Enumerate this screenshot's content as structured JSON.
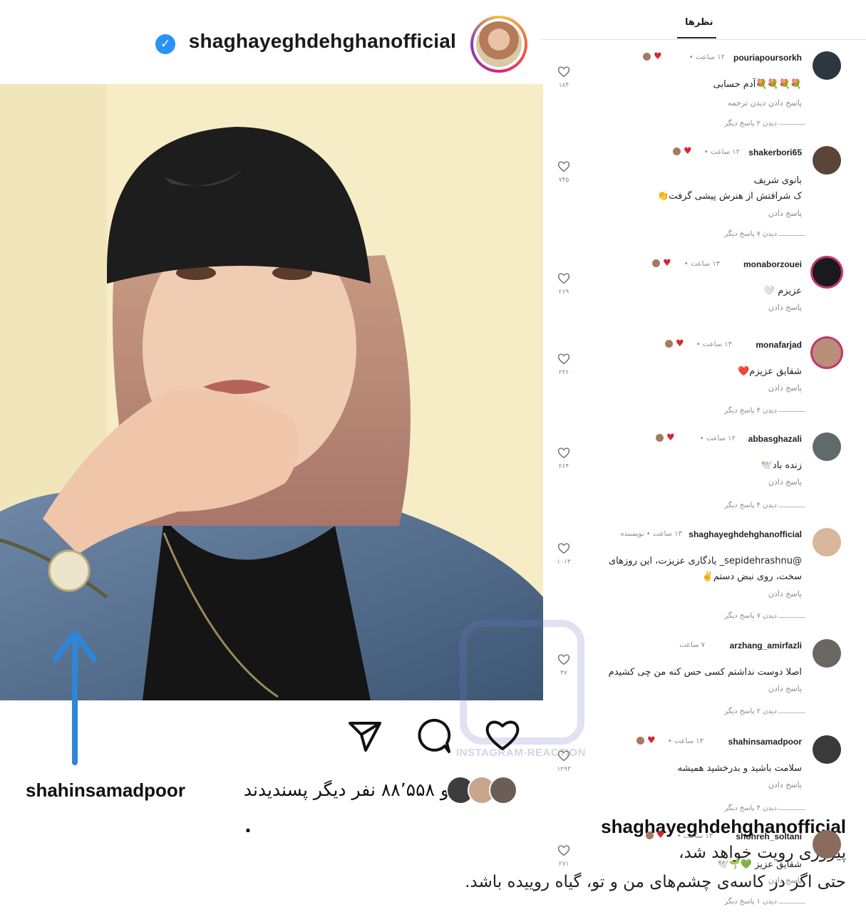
{
  "post": {
    "username": "shaghayeghdehghanofficial",
    "verified_mark": "✓",
    "likes": {
      "liked_by": "shahinsamadpoor",
      "text": "و ۸۸٬۵۵۸ نفر دیگر پسندیدند"
    },
    "caption": {
      "user": "shaghayeghdehghanofficial",
      "dot": ".",
      "lines": [
        "پیروزی رویت خواهد شد،",
        "حتی اگر در کاسه‌ی چشم‌های من و تو، گیاه روییده باشد."
      ]
    },
    "icons": [
      "share-icon",
      "comment-icon",
      "like-heart-icon",
      "verified-badge-icon"
    ]
  },
  "comments_panel": {
    "title": "نظرها",
    "reply_label": "پاسخ دادن",
    "comments": [
      {
        "user": "pouriapoursorkh",
        "time": "۱۲ ساعت •",
        "text": [
          "💐💐💐💐آدم حسابی"
        ],
        "reply": "پاسخ دادن      دیدن ترجمه",
        "more": "دیدن ۲ پاسخ دیگر",
        "likes": "۱۸۴"
      },
      {
        "user": "shakerbori65",
        "time": "۱۲ ساعت •",
        "text": [
          "بانوی شریف",
          "ک شرافتش از هنرش پیشی گرفت👏"
        ],
        "reply": "پاسخ دادن",
        "more": "دیدن ۷ پاسخ دیگر",
        "likes": "۷۴۵"
      },
      {
        "user": "monaborzouei",
        "time": "۱۳ ساعت •",
        "text": [
          "عزیزم 🤍"
        ],
        "reply": "پاسخ دادن",
        "more": "",
        "likes": "۲۶۹"
      },
      {
        "user": "monafarjad",
        "time": "۱۳ ساعت •",
        "text": [
          "شقایق عزیزم❤️"
        ],
        "reply": "پاسخ دادن",
        "more": "دیدن ۴ پاسخ دیگر",
        "likes": "۲۲۶"
      },
      {
        "user": "abbasghazali",
        "time": "۱۲ ساعت •",
        "text": [
          "زنده باد🕊️"
        ],
        "reply": "پاسخ دادن",
        "more": "دیدن ۴ پاسخ دیگر",
        "likes": "۲۶۴"
      },
      {
        "user": "shaghayeghdehghanofficial",
        "time": "۱۳ ساعت • نویسنده",
        "text": [
          "@sepidehrashnu_ یادگاری عزیزت، این روزهای",
          "سخت، روی نبض دستم✌️"
        ],
        "reply": "پاسخ دادن",
        "more": "دیدن ۷ پاسخ دیگر",
        "likes": "۱۰۱۳"
      },
      {
        "user": "arzhang_amirfazli",
        "time": "۷ ساعت",
        "text": [
          "اصلا دوست نداشتم کسی حس کنه من چی کشیدم"
        ],
        "reply": "پاسخ دادن",
        "more": "دیدن ۲ پاسخ دیگر",
        "likes": "۴۷"
      },
      {
        "user": "shahinsamadpoor",
        "time": "۱۳ ساعت •",
        "text": [
          "سلامت باشید و بدرخشید همیشه"
        ],
        "reply": "پاسخ دادن",
        "more": "دیدن ۴ پاسخ دیگر",
        "likes": "۱۲۹۳"
      },
      {
        "user": "shohreh_soltani",
        "time": "۱۳ ساعت •",
        "text": [
          "شقایق عزیز 💚🌱🕊️"
        ],
        "reply": "پاسخ دادن",
        "more": "دیدن ۱ پاسخ دیگر",
        "likes": "۲۷۱"
      }
    ]
  },
  "watermark": {
    "text": "INSTAGRAM-REACTION"
  }
}
